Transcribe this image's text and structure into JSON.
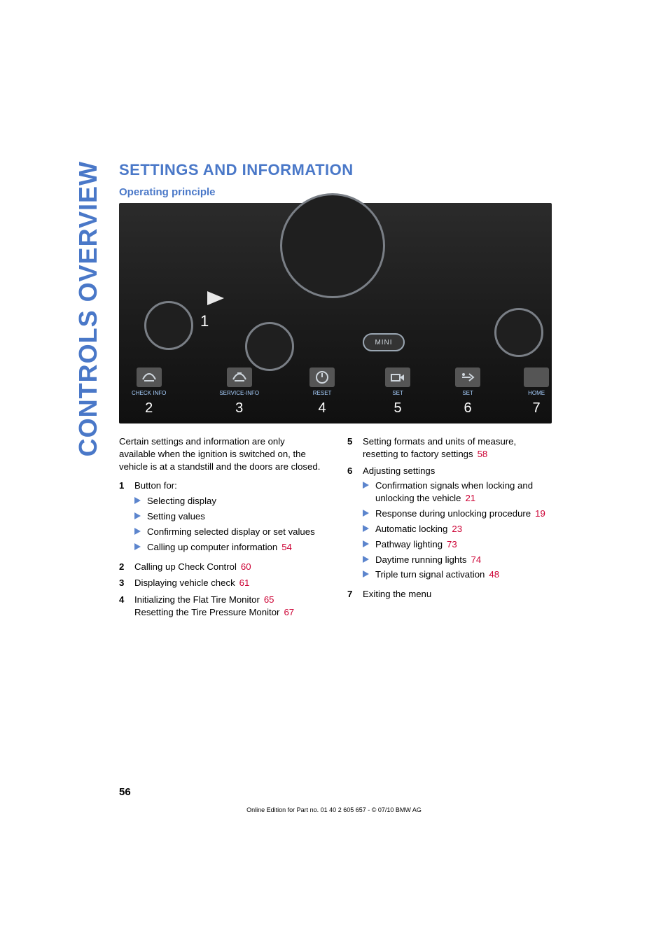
{
  "sidebar": {
    "label": "CONTROLS OVERVIEW"
  },
  "page_title": "SETTINGS AND INFORMATION",
  "section_heading": "Operating principle",
  "figure": {
    "mini_badge": "MINI",
    "arrow_num": "1",
    "icons": [
      {
        "num": "2",
        "label": "CHECK INFO",
        "name": "check-info-icon"
      },
      {
        "num": "3",
        "label": "SERVICE-INFO",
        "name": "service-info-icon"
      },
      {
        "num": "4",
        "label": "RESET",
        "name": "reset-icon"
      },
      {
        "num": "5",
        "label": "SET",
        "name": "set-a-icon"
      },
      {
        "num": "6",
        "label": "SET",
        "name": "set-b-icon"
      },
      {
        "num": "7",
        "label": "HOME",
        "name": "home-icon"
      }
    ]
  },
  "intro": "Certain settings and information are only available when the ignition is switched on, the vehicle is at a standstill and the doors are closed.",
  "left_list": {
    "item1": {
      "n": "1",
      "text": "Button for:",
      "bullets": [
        {
          "text": "Selecting display"
        },
        {
          "text": "Setting values"
        },
        {
          "text": "Confirming selected display or set values"
        },
        {
          "text": "Calling up computer information",
          "ref": "54"
        }
      ]
    },
    "item2": {
      "n": "2",
      "text": "Calling up Check Control",
      "ref": "60"
    },
    "item3": {
      "n": "3",
      "text": "Displaying vehicle check",
      "ref": "61"
    },
    "item4": {
      "n": "4",
      "line1": "Initializing the Flat Tire Monitor",
      "ref1": "65",
      "line2": "Resetting the Tire Pressure Monitor",
      "ref2": "67"
    }
  },
  "right_list": {
    "item5": {
      "n": "5",
      "text": "Setting formats and units of measure, resetting to factory settings",
      "ref": "58"
    },
    "item6": {
      "n": "6",
      "text": "Adjusting settings",
      "bullets": [
        {
          "text": "Confirmation signals when locking and unlocking the vehicle",
          "ref": "21"
        },
        {
          "text": "Response during unlocking procedure",
          "ref": "19"
        },
        {
          "text": "Automatic locking",
          "ref": "23"
        },
        {
          "text": "Pathway lighting",
          "ref": "73"
        },
        {
          "text": "Daytime running lights",
          "ref": "74"
        },
        {
          "text": "Triple turn signal activation",
          "ref": "48"
        }
      ]
    },
    "item7": {
      "n": "7",
      "text": "Exiting the menu"
    }
  },
  "page_number": "56",
  "footer": "Online Edition for Part no. 01 40 2 605 657 - © 07/10  BMW AG"
}
